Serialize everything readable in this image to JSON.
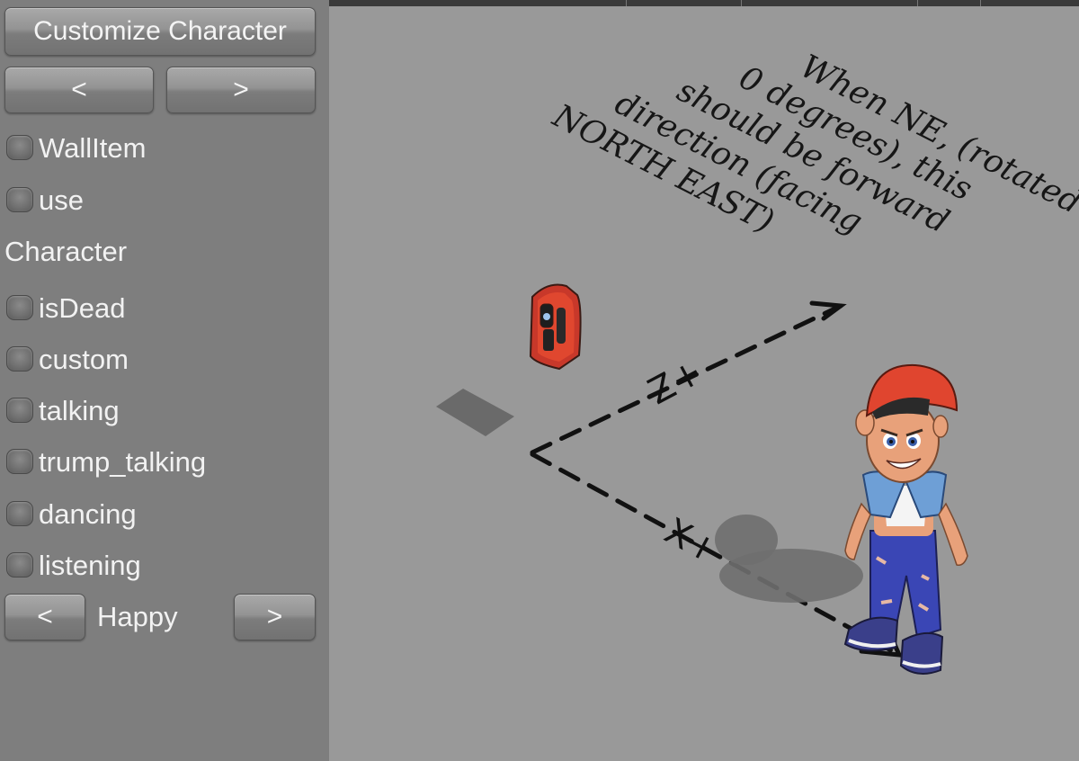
{
  "panel": {
    "customize_label": "Customize Character",
    "prev_label": "<",
    "next_label": ">",
    "toggles_top": [
      {
        "label": "WallItem"
      },
      {
        "label": "use"
      }
    ],
    "section_label": "Character",
    "toggles_character": [
      {
        "label": "isDead"
      },
      {
        "label": "custom"
      },
      {
        "label": "talking"
      },
      {
        "label": "trump_talking"
      },
      {
        "label": "dancing"
      },
      {
        "label": "listening"
      }
    ],
    "mood": {
      "prev_label": "<",
      "value": "Happy",
      "next_label": ">"
    }
  },
  "scene": {
    "note_lines": [
      "When NE, (rotated",
      "0 degrees), this",
      "should be forward",
      "direction (facing",
      "NORTH EAST)"
    ],
    "axis_z_label": "Z+",
    "axis_x_label": "X+",
    "colors": {
      "ground": "#999999",
      "panel": "#7e7e7e",
      "phone": "#e0472f",
      "cap": "#e0452f",
      "jeans": "#3a46b5",
      "shirt": "#6e9fd6"
    }
  }
}
